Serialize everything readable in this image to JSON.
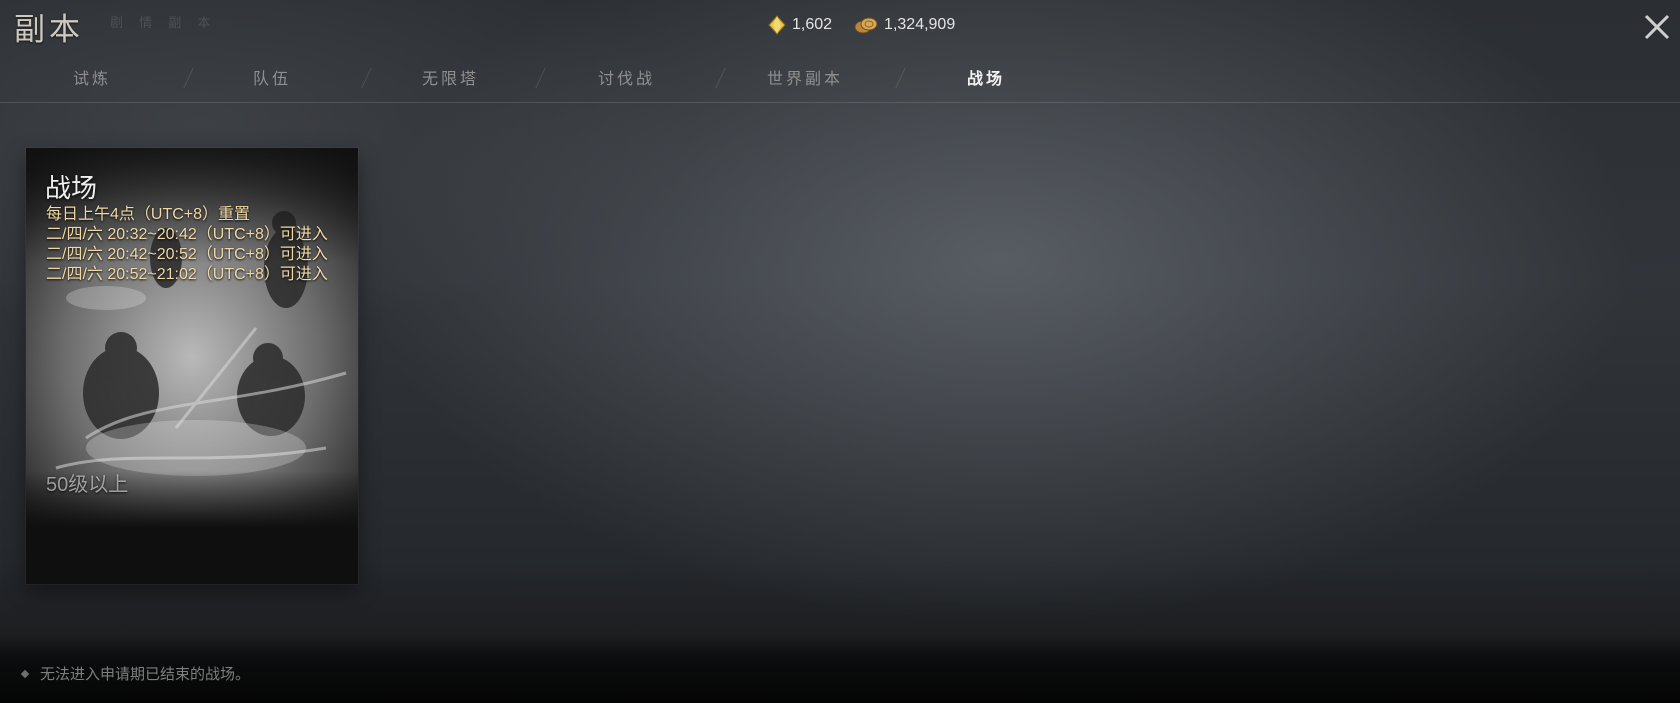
{
  "window": {
    "title": "副本",
    "subtitle": "剧 情 副 本"
  },
  "currency": {
    "gems": "1,602",
    "gold": "1,324,909"
  },
  "tabs": [
    {
      "label": "试炼",
      "active": false
    },
    {
      "label": "队伍",
      "active": false
    },
    {
      "label": "无限塔",
      "active": false
    },
    {
      "label": "讨伐战",
      "active": false
    },
    {
      "label": "世界副本",
      "active": false
    },
    {
      "label": "战场",
      "active": true
    }
  ],
  "card": {
    "title": "战场",
    "reset_info": "每日上午4点（UTC+8）重置",
    "schedule": [
      "二/四/六 20:32~20:42（UTC+8）可进入",
      "二/四/六 20:42~20:52（UTC+8）可进入",
      "二/四/六 20:52~21:02（UTC+8）可进入"
    ],
    "level_requirement": "50级以上"
  },
  "footer": {
    "notice": "无法进入申请期已结束的战场。"
  },
  "icons": {
    "gems": "gem-icon",
    "gold": "gold-coin-icon",
    "close": "close-icon",
    "bullet": "bullet-icon"
  },
  "colors": {
    "accent_text": "#f0d9a6",
    "active_tab": "#f2f2f2",
    "inactive_tab": "#8f8f8f",
    "gem": "#e8c14a",
    "gold": "#c89a4c"
  }
}
